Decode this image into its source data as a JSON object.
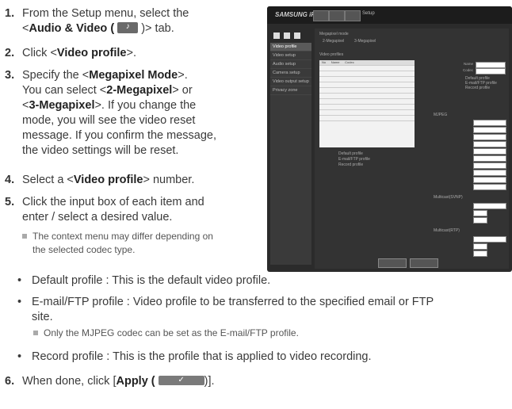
{
  "steps": [
    {
      "num": "1.",
      "pre": "From the Setup menu, select the",
      "line2_pre": "<",
      "bold": "Audio & Video (",
      "icon": "audio-video-icon",
      "post": ")> tab."
    },
    {
      "num": "2.",
      "pre": "Click <",
      "bold": "Video profile",
      "post": ">."
    },
    {
      "num": "3.",
      "text": "Specify the <Megapixel Mode>. You can select <2-Megapixel> or <3-Megapixel>. If you change the mode, you will see the video reset message. If you confirm the message, the video settings will be reset.",
      "l1_pre": "Specify the <",
      "l1_bold": "Megapixel Mode",
      "l1_post": ">.",
      "l2_pre": "You can select <",
      "l2_bold": "2-Megapixel",
      "l2_post": "> or",
      "l3_pre": "<",
      "l3_bold": "3-Megapixel",
      "l3_post": ">. If you change the",
      "l4": "mode, you will see the video reset",
      "l5": "message. If you confirm the message,",
      "l6": "the video settings will be reset."
    },
    {
      "num": "4.",
      "pre": "Select a <",
      "bold": "Video profile",
      "post": "> number."
    },
    {
      "num": "5.",
      "l1": "Click the input box of each item and",
      "l2": "enter / select a desired value."
    },
    {
      "num": "6.",
      "pre": "When done, click [",
      "bold": "Apply (",
      "post": ")]."
    }
  ],
  "note1": {
    "l1": "The context menu may differ depending on",
    "l2": "the selected codec type."
  },
  "bullets": [
    {
      "text": "Default profile : This is the default video profile."
    },
    {
      "l1": "E-mail/FTP profile : Video profile to be transferred to the specified email or FTP",
      "l2": "site."
    },
    {
      "text": "Record profile : This is the profile that is applied to video recording."
    }
  ],
  "note2": "Only the MJPEG codec can be set as the E-mail/FTP profile.",
  "shot": {
    "logo": "SAMSUNG iPOLiS",
    "top_label": "Setup",
    "side_items": [
      "Video profile",
      "Video setup",
      "Audio setup",
      "Camera setup",
      "Video output setup",
      "Privacy zone"
    ],
    "mp_label": "Megapixel mode",
    "mp_opt1": "2-Megapixel",
    "mp_opt2": "3-Megapixel",
    "vp_label": "Video profiles",
    "col_no": "No",
    "col_name": "Name",
    "col_codec": "Codec",
    "def_profile": "Default profile",
    "email_profile": "E-mail/FTP profile",
    "rec_profile": "Record profile",
    "name_label": "Name",
    "codec_label": "Codec",
    "default_label": "Default profile",
    "email_label": "E-mail/FTP profile",
    "record_label": "Record profile",
    "detail_label": "MJPEG",
    "ip_label": "Multicast(SVNP)",
    "ip_label2": "Multicast(RTP)"
  }
}
